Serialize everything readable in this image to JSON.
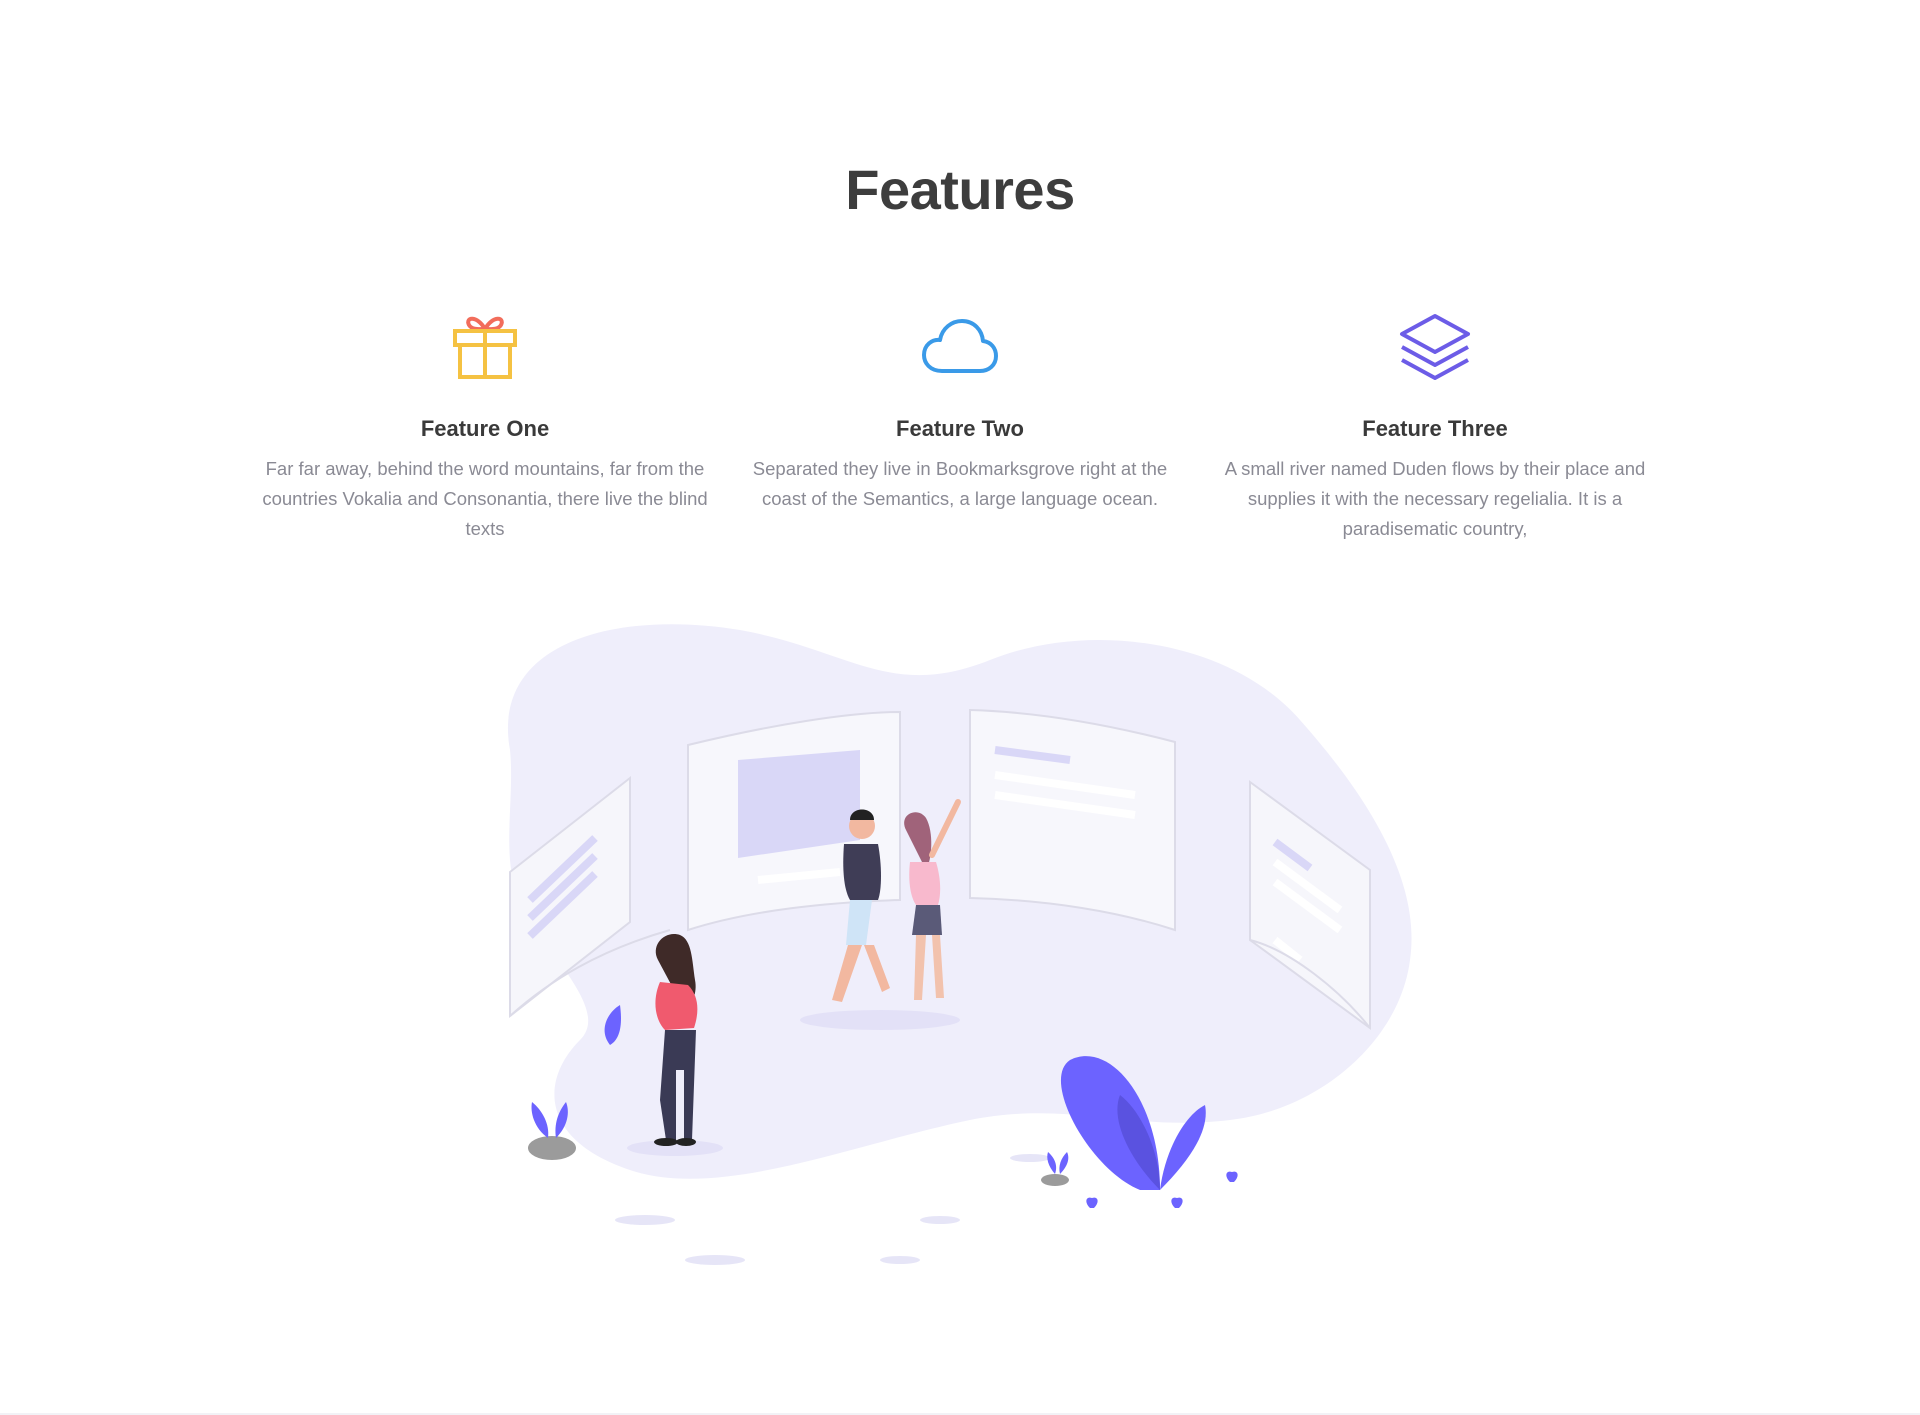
{
  "section": {
    "title": "Features"
  },
  "features": [
    {
      "icon": "gift-icon",
      "icon_color": "#f5c242",
      "icon_accent": "#f26d5b",
      "title": "Feature One",
      "text": "Far far away, behind the word mountains, far from the countries Vokalia and Consonantia, there live the blind texts"
    },
    {
      "icon": "cloud-icon",
      "icon_color": "#3a9ae8",
      "title": "Feature Two",
      "text": "Separated they live in Bookmarksgrove right at the coast of the Semantics, a large language ocean."
    },
    {
      "icon": "layers-icon",
      "icon_color": "#6c5ce7",
      "title": "Feature Three",
      "text": "A small river named Duden flows by their place and supplies it with the necessary regelialia. It is a paradisematic country,"
    }
  ],
  "colors": {
    "illustration_blob": "#efeefb",
    "illustration_accent": "#6c63ff",
    "panel": "#f6f6fb",
    "panel_highlight": "#d9d7f7"
  }
}
